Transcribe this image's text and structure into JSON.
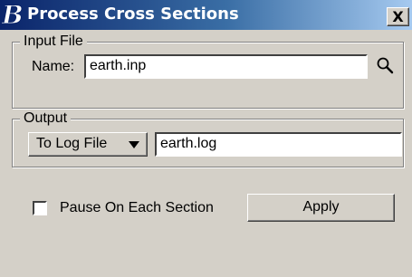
{
  "window": {
    "title": "Process Cross Sections",
    "close_label": "X"
  },
  "input_file": {
    "group_label": "Input File",
    "name_label": "Name:",
    "name_value": "earth.inp",
    "browse_icon": "magnifier-icon"
  },
  "output": {
    "group_label": "Output",
    "mode_label": "To Log File",
    "mode_icon": "triangle-down-icon",
    "file_value": "earth.log"
  },
  "options": {
    "pause_label": "Pause On Each Section",
    "pause_checked": false
  },
  "actions": {
    "apply_label": "Apply"
  },
  "colors": {
    "title_gradient_start": "#0a246a",
    "title_gradient_end": "#a6caf0",
    "dialog_background": "#d4d0c8"
  }
}
